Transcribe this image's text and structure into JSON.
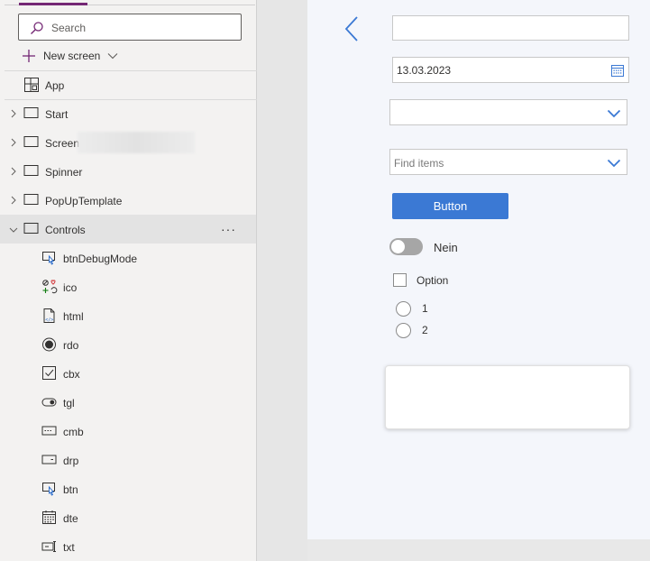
{
  "tree": {
    "search_placeholder": "Search",
    "new_screen_label": "New screen",
    "items": [
      {
        "label": "App",
        "icon": "app-icon"
      },
      {
        "label": "Start",
        "icon": "screen-icon"
      },
      {
        "label": "Screen",
        "icon": "screen-icon"
      },
      {
        "label": "Spinner",
        "icon": "screen-icon"
      },
      {
        "label": "PopUpTemplate",
        "icon": "screen-icon"
      },
      {
        "label": "Controls",
        "icon": "screen-icon",
        "more": "···"
      }
    ],
    "children": [
      {
        "label": "btnDebugMode",
        "icon": "button-control-icon"
      },
      {
        "label": "ico",
        "icon": "icons-control-icon"
      },
      {
        "label": "html",
        "icon": "html-text-icon"
      },
      {
        "label": "rdo",
        "icon": "radio-control-icon"
      },
      {
        "label": "cbx",
        "icon": "checkbox-control-icon"
      },
      {
        "label": "tgl",
        "icon": "toggle-control-icon"
      },
      {
        "label": "cmb",
        "icon": "combobox-control-icon"
      },
      {
        "label": "drp",
        "icon": "dropdown-control-icon"
      },
      {
        "label": "btn",
        "icon": "button-control-icon"
      },
      {
        "label": "dte",
        "icon": "date-picker-icon"
      },
      {
        "label": "txt",
        "icon": "text-input-icon"
      }
    ]
  },
  "canvas": {
    "text_input_value": "",
    "date_value": "13.03.2023",
    "dropdown_value": "",
    "combobox_placeholder": "Find items",
    "button_label": "Button",
    "toggle_label": "Nein",
    "toggle_on": false,
    "checkbox_label": "Option",
    "checkbox_checked": false,
    "radio_options": [
      "1",
      "2"
    ],
    "accent_color": "#3b79d4"
  },
  "colors": {
    "tree_bg": "#f3f2f1",
    "selected_row": "#e3e3e3",
    "canvas_bg": "#f4f6fb",
    "brand_purple": "#742774"
  }
}
